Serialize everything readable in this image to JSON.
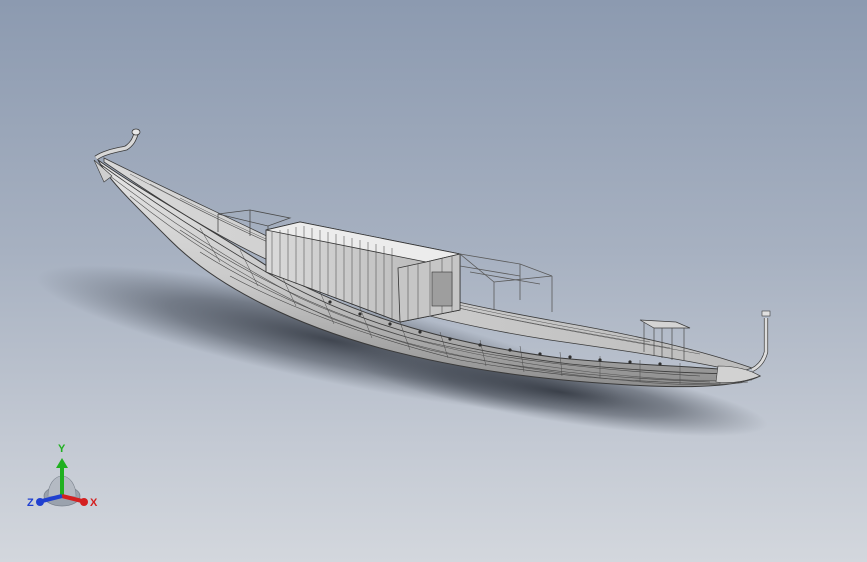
{
  "viewport": {
    "background_top": "#8c9ab0",
    "background_bottom": "#d3d7dd"
  },
  "model": {
    "hull_color": "#c8c8c8",
    "line_color": "#3a3a3a"
  },
  "triad": {
    "x_label": "X",
    "y_label": "Y",
    "z_label": "Z",
    "x_color": "#d42020",
    "y_color": "#20b020",
    "z_color": "#2040d0"
  }
}
